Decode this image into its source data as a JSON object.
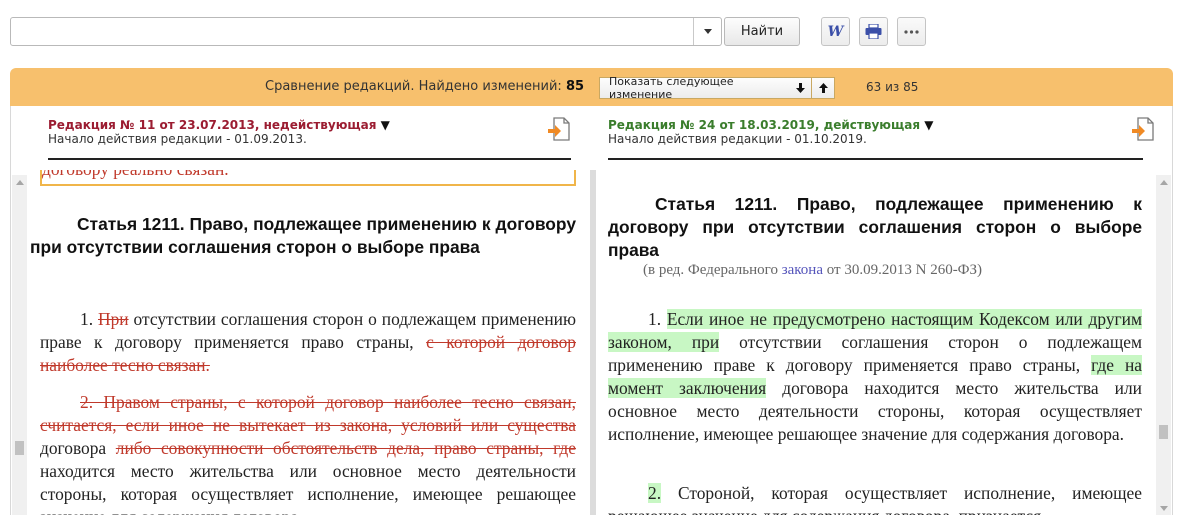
{
  "toolbar": {
    "search_value": "",
    "find_label": "Найти",
    "word_icon_letter": "W"
  },
  "compare": {
    "text": "Сравнение редакций. Найдено изменений:",
    "count": "85",
    "next_label": "Показать следующее изменение",
    "counter": "63 из 85"
  },
  "left": {
    "title": "Редакция № 11 от 23.07.2013, недействующая",
    "subtitle": "Начало действия редакции - 01.09.2013.",
    "prev_line": "договору реально связан.",
    "heading": "Статья 1211. Право, подлежащее применению к договору при отсутствии соглашения сторон о выборе права",
    "p1": {
      "num": "1.",
      "del_a": "При",
      "t_a": "отсутствии соглашения сторон о подлежащем применению праве к договору применяется право страны,",
      "del_b": "с которой договор наиболее тесно связан."
    },
    "p2": {
      "del_a": "2. Правом страны, с которой договор наиболее тесно связан, считается, если иное не вытекает из закона, условий или существа",
      "t_a": "договора",
      "del_b": "либо совокупности обстоятельств дела, право страны, где",
      "t_b": "находится место жительства или основное место деятельности стороны, которая осуществляет исполнение, имеющее решающее значение для содержания договора."
    }
  },
  "right": {
    "title": "Редакция № 24 от 18.03.2019, действующая",
    "subtitle": "Начало действия редакции - 01.10.2019.",
    "heading": "Статья 1211. Право, подлежащее применению к договору при отсутствии соглашения сторон о выборе права",
    "note_a": "(в ред. Федерального",
    "note_link": "закона",
    "note_b": "от 30.09.2013 N 260-ФЗ)",
    "p1": {
      "num": "1.",
      "ins_a": "Если иное не предусмотрено настоящим Кодексом или другим законом, при",
      "t_a": "отсутствии соглашения сторон о подлежащем применению праве к договору применяется право страны,",
      "ins_b": "где на момент заключения",
      "t_b": "договора находится место жительства или основное место деятельности стороны, которая осуществляет исполнение, имеющее решающее значение для содержания договора."
    },
    "p2": {
      "num": "2.",
      "t_a": "Стороной, которая осуществляет исполнение, имеющее решающее значение для содержания договора, признается"
    }
  },
  "colors": {
    "compare_bar": "#f7c06d",
    "left_title": "#9b1c31",
    "right_title": "#3a7d2c",
    "deleted_text": "#c0392b",
    "inserted_bg": "#c8f7c4"
  },
  "icons": [
    "chevron-down-icon",
    "word-icon",
    "print-icon",
    "more-icon",
    "arrow-down-icon",
    "arrow-up-icon",
    "export-icon"
  ]
}
